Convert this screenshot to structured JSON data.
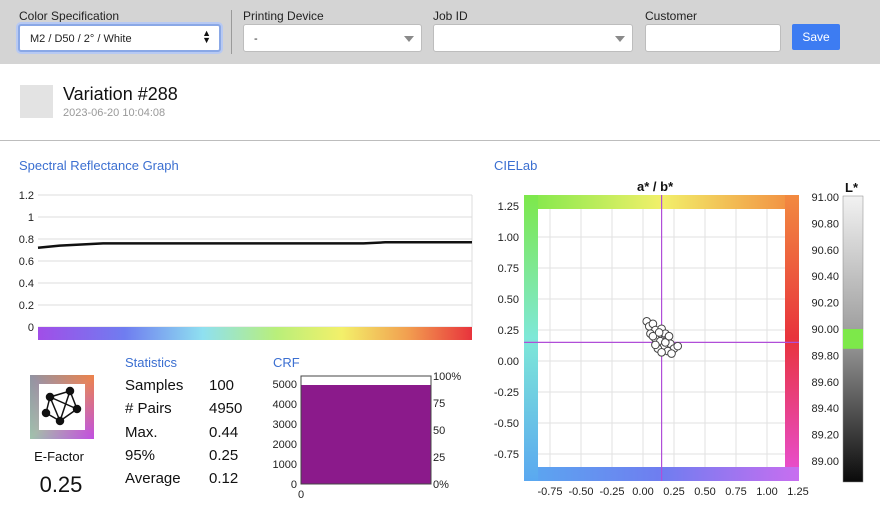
{
  "toolbar": {
    "color_spec_label": "Color Specification",
    "color_spec_value": "M2 / D50 / 2° / White",
    "printing_device_label": "Printing Device",
    "printing_device_value": "-",
    "job_id_label": "Job ID",
    "job_id_value": "",
    "customer_label": "Customer",
    "customer_value": "",
    "save_label": "Save"
  },
  "variation": {
    "title": "Variation #288",
    "date": "2023-06-20 10:04:08",
    "swatch_color": "#e3e3e3"
  },
  "spectral": {
    "title": "Spectral Reflectance Graph"
  },
  "statistics": {
    "title": "Statistics",
    "rows": [
      {
        "label": "Samples",
        "value": "100"
      },
      {
        "label": "# Pairs",
        "value": "4950"
      },
      {
        "label": "Max.",
        "value": "0.44"
      },
      {
        "label": "95%",
        "value": "0.25"
      },
      {
        "label": "Average",
        "value": "0.12"
      }
    ]
  },
  "efactor": {
    "label": "E-Factor",
    "value": "0.25"
  },
  "crf": {
    "title": "CRF"
  },
  "cielab": {
    "title": "CIELab",
    "ab_title": "a* / b*",
    "l_title": "L*"
  },
  "chart_data": [
    {
      "type": "line",
      "name": "spectral",
      "title": "",
      "x": [
        0,
        0.05,
        0.1,
        0.15,
        0.2,
        0.25,
        0.3,
        0.35,
        0.4,
        0.45,
        0.5,
        0.55,
        0.6,
        0.65,
        0.7,
        0.75,
        0.8,
        0.85,
        0.9,
        0.95,
        1.0
      ],
      "values": [
        0.72,
        0.74,
        0.75,
        0.76,
        0.76,
        0.76,
        0.76,
        0.76,
        0.76,
        0.76,
        0.76,
        0.76,
        0.76,
        0.76,
        0.76,
        0.76,
        0.77,
        0.77,
        0.77,
        0.77,
        0.77
      ],
      "yticks": [
        "0",
        "0.2",
        "0.4",
        "0.6",
        "0.8",
        "1",
        "1.2"
      ],
      "ylim": [
        0,
        1.2
      ]
    },
    {
      "type": "area",
      "name": "crf",
      "title": "",
      "x": [
        0,
        0.01,
        1
      ],
      "values": [
        4950,
        4950,
        4950
      ],
      "total": 4950,
      "fill": "#8b1a8b",
      "yticks_left": [
        "0",
        "1000",
        "2000",
        "3000",
        "4000",
        "5000"
      ],
      "yticks_right": [
        "0%",
        "25",
        "50",
        "75",
        "100%"
      ],
      "xticks": [
        "0"
      ]
    },
    {
      "type": "scatter",
      "name": "ab",
      "title": "",
      "crosshair": {
        "a": 0.15,
        "b": 0.15
      },
      "points": [
        [
          0.03,
          0.32
        ],
        [
          0.05,
          0.28
        ],
        [
          0.08,
          0.3
        ],
        [
          0.1,
          0.25
        ],
        [
          0.06,
          0.22
        ],
        [
          0.12,
          0.2
        ],
        [
          0.15,
          0.26
        ],
        [
          0.1,
          0.18
        ],
        [
          0.14,
          0.16
        ],
        [
          0.18,
          0.22
        ],
        [
          0.2,
          0.18
        ],
        [
          0.17,
          0.12
        ],
        [
          0.12,
          0.1
        ],
        [
          0.22,
          0.14
        ],
        [
          0.25,
          0.1
        ],
        [
          0.2,
          0.08
        ],
        [
          0.15,
          0.07
        ],
        [
          0.1,
          0.13
        ],
        [
          0.28,
          0.12
        ],
        [
          0.23,
          0.06
        ],
        [
          0.18,
          0.15
        ],
        [
          0.08,
          0.2
        ],
        [
          0.13,
          0.23
        ],
        [
          0.21,
          0.2
        ]
      ],
      "xticks": [
        "-0.75",
        "-0.50",
        "-0.25",
        "0.00",
        "0.25",
        "0.50",
        "0.75",
        "1.00",
        "1.25"
      ],
      "yticks": [
        "1.25",
        "1.00",
        "0.75",
        "0.50",
        "0.25",
        "0.00",
        "-0.25",
        "-0.50",
        "-0.75"
      ],
      "xlim": [
        -1.0,
        1.25
      ],
      "ylim": [
        -0.9,
        1.25
      ]
    },
    {
      "type": "bar",
      "name": "lightness",
      "title": "",
      "ticks": [
        "91.00",
        "90.80",
        "90.60",
        "90.40",
        "90.20",
        "90.00",
        "89.80",
        "89.60",
        "89.40",
        "89.20",
        "89.00"
      ],
      "highlight": {
        "from": 89.85,
        "to": 90.0,
        "color": "#7de84a"
      }
    }
  ]
}
